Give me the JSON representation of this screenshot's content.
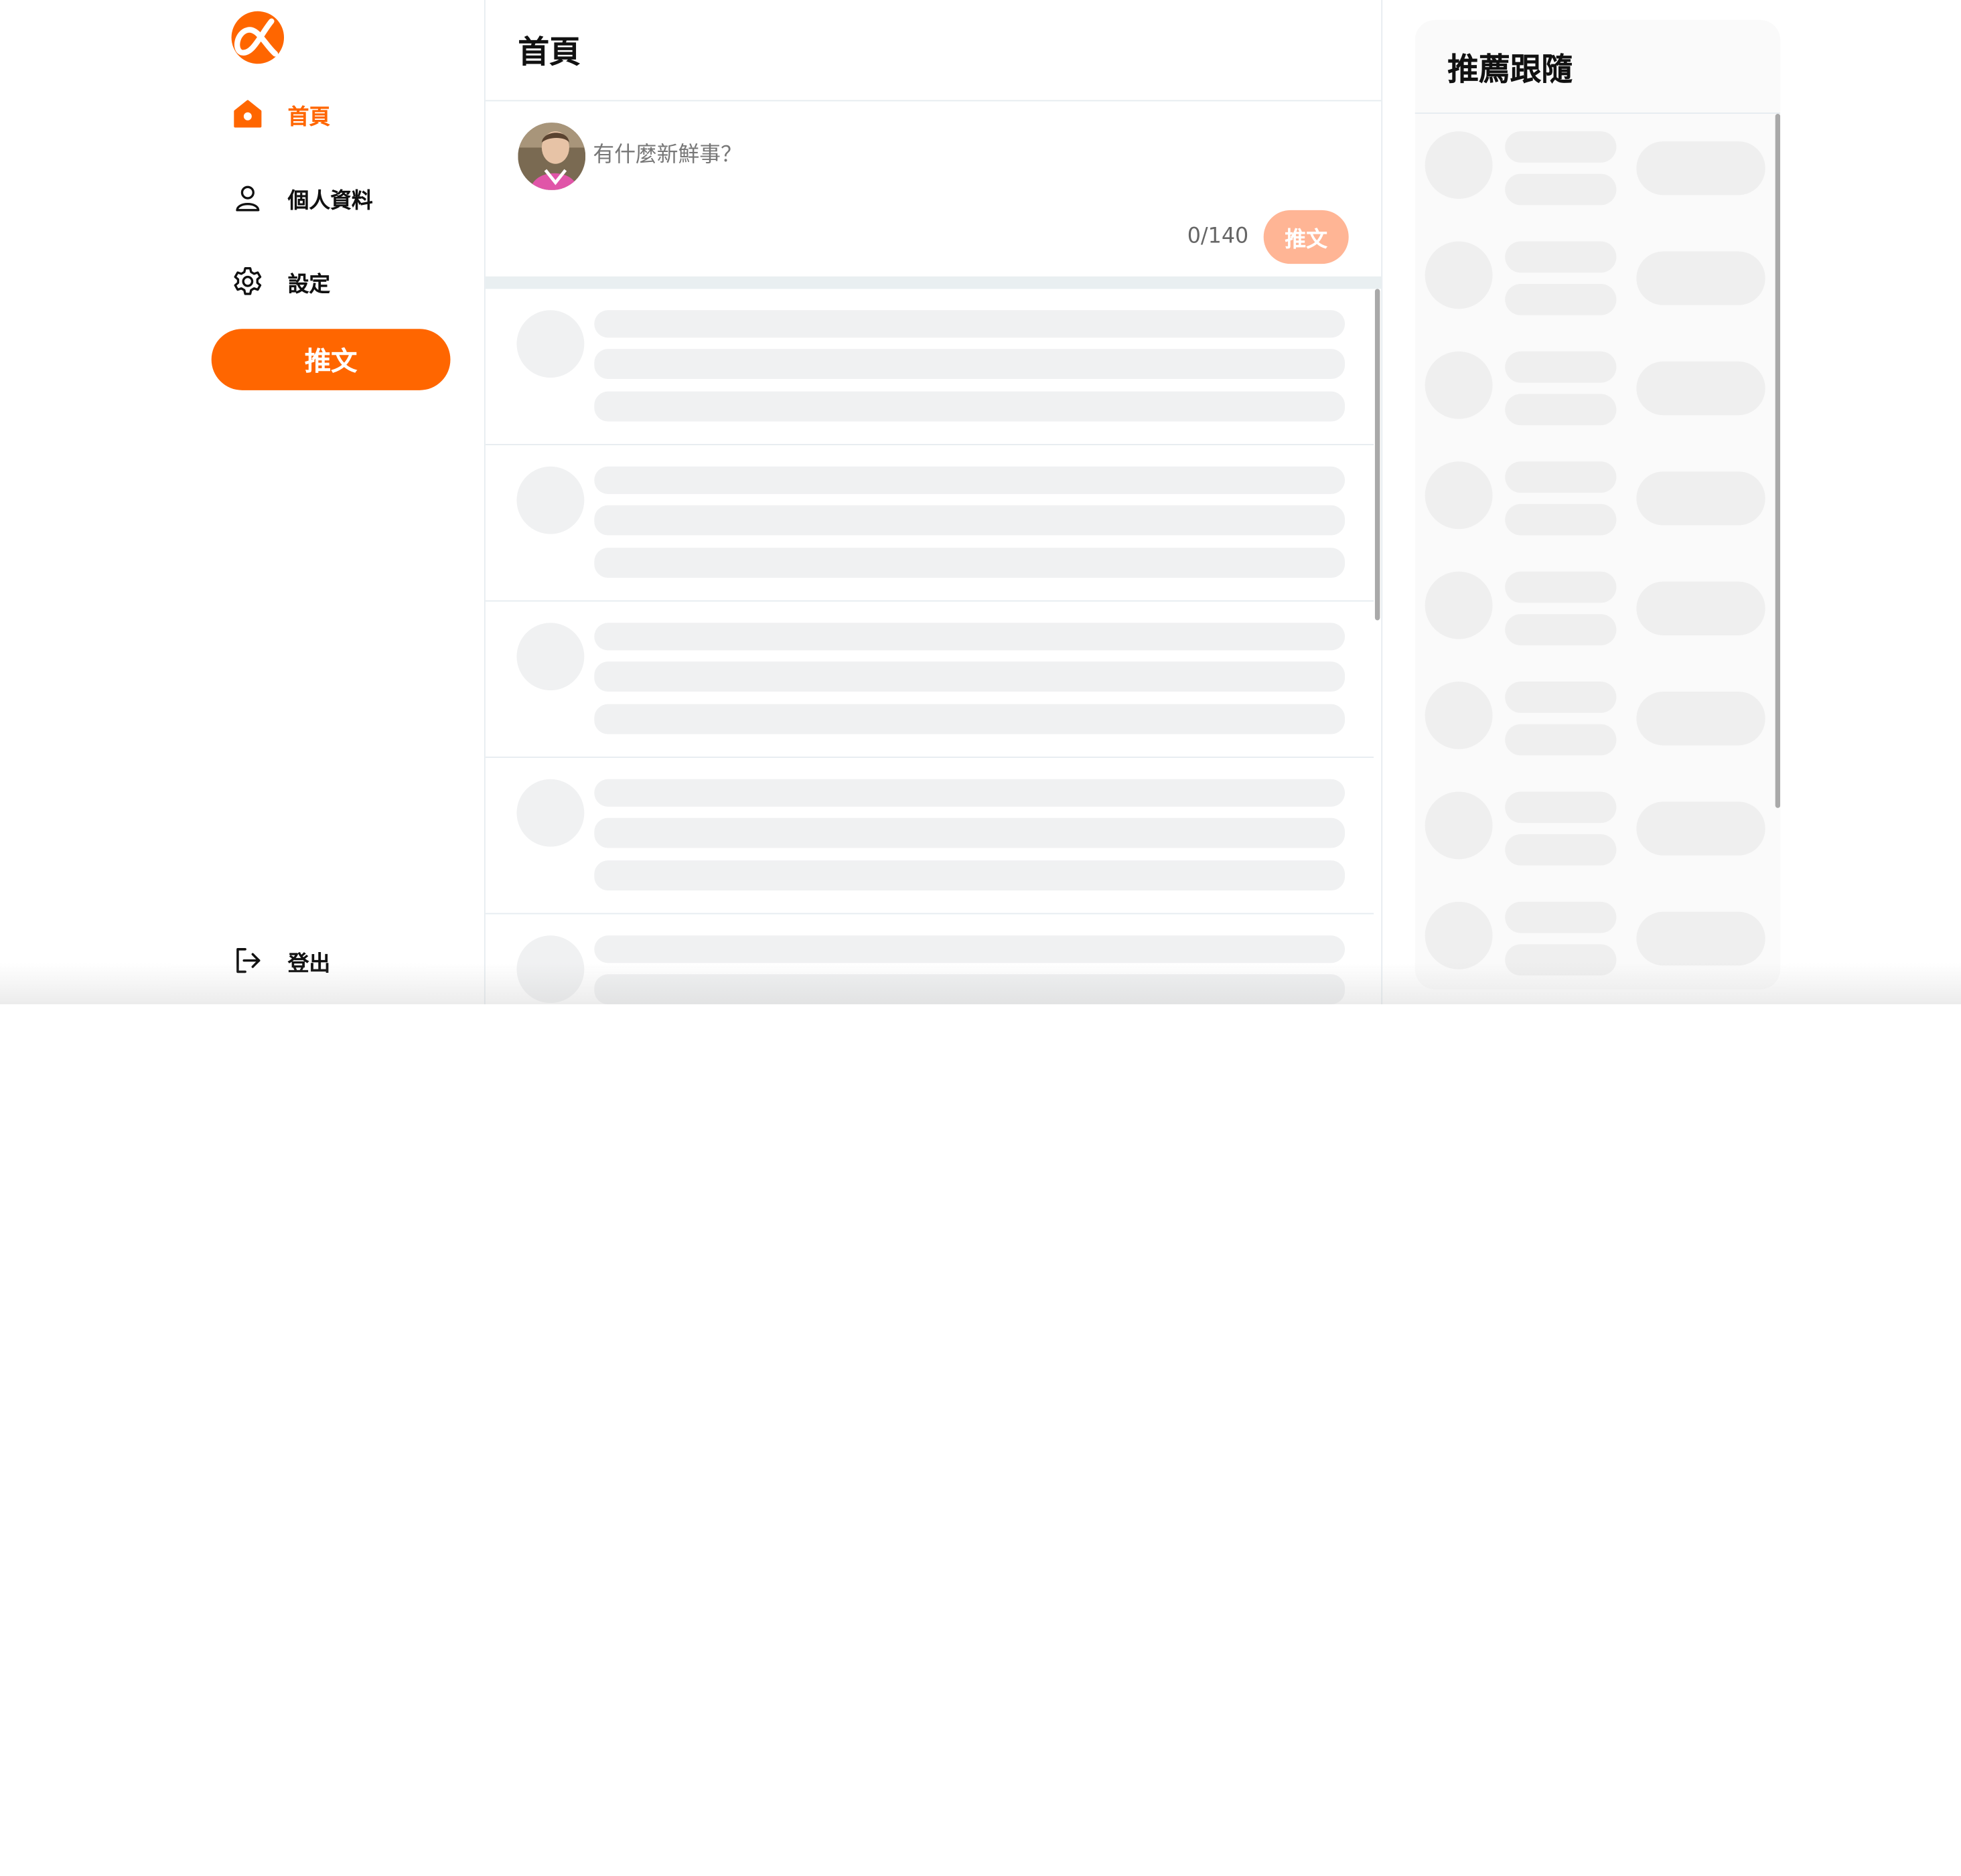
{
  "sidebar": {
    "logo_icon": "alpha-logo",
    "brand_color": "#ff6600",
    "nav": [
      {
        "label": "首頁",
        "icon": "home-icon",
        "active": true
      },
      {
        "label": "個人資料",
        "icon": "user-icon",
        "active": false
      },
      {
        "label": "設定",
        "icon": "gear-icon",
        "active": false
      }
    ],
    "tweet_button": "推文",
    "logout": {
      "label": "登出",
      "icon": "logout-icon"
    }
  },
  "main": {
    "title": "首頁",
    "composer": {
      "placeholder": "有什麼新鮮事？",
      "counter": "0/140",
      "tweet_button": "推文"
    },
    "loading_posts": 5
  },
  "suggestions": {
    "title": "推薦跟隨",
    "loading_users": 8
  }
}
